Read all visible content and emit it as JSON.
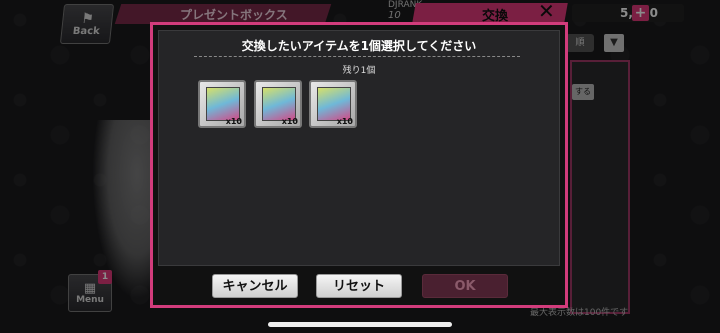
{
  "header": {
    "back_label": "Back",
    "back_icon": "flag-icon",
    "title": "プレゼントボックス",
    "rank_label": "DJRANK",
    "rank_value": "10",
    "exchange_label": "交換",
    "currency_value": "5,480",
    "plus_label": "+"
  },
  "background": {
    "sort_label": "順",
    "side_button_label": "する",
    "bottom_note": "最大表示数は100件です",
    "menu_label": "Menu",
    "menu_badge": "1"
  },
  "dialog": {
    "title": "交換したいアイテムを1個選択してください",
    "remaining": "残り1個",
    "items": [
      {
        "qty": "x10"
      },
      {
        "qty": "x10"
      },
      {
        "qty": "x10"
      }
    ],
    "cancel_label": "キャンセル",
    "reset_label": "リセット",
    "ok_label": "OK"
  },
  "colors": {
    "accent": "#e0397a",
    "dialog_border": "#d23c7c"
  }
}
